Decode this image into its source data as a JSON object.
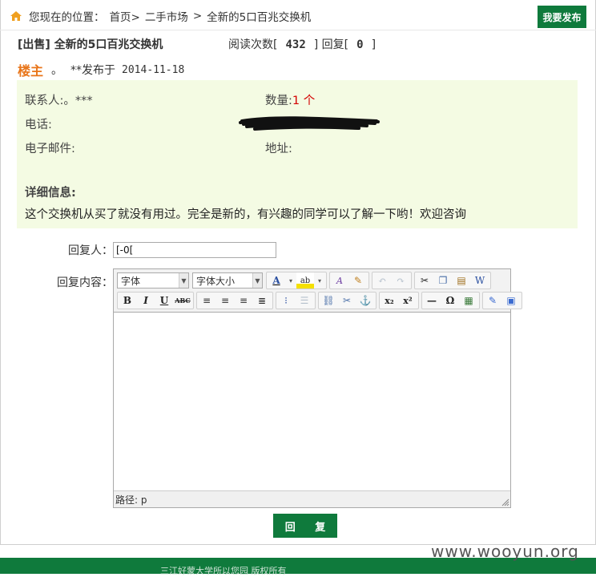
{
  "breadcrumb": {
    "prefix": "您现在的位置：",
    "items": [
      "首页>",
      "二手市场",
      ">",
      "全新的5口百兆交换机"
    ]
  },
  "publish_button": "我要发布",
  "post": {
    "title": "[出售] 全新的5口百兆交换机",
    "views_label": "阅读次数[",
    "views": "432",
    "replies_label": "] 回复[",
    "replies": "0",
    "replies_end": "]",
    "owner": "楼主",
    "dot": "。",
    "posted_label": "**发布于",
    "date": "2014-11-18"
  },
  "info": {
    "contact_label": "联系人:",
    "contact_value": "。***",
    "quantity_label": "数量:",
    "quantity_value": "1 个",
    "phone_label": "电话:",
    "email_label": "电子邮件:",
    "address_label": "地址:",
    "detail_title": "详细信息:",
    "detail_text": "这个交换机从买了就没有用过。完全是新的，有兴趣的同学可以了解一下哟！欢迎咨询"
  },
  "form": {
    "replier_label": "回复人：",
    "replier_value": "[-0[",
    "content_label": "回复内容：",
    "font_select": "字体",
    "size_select": "字体大小",
    "status_path": "路径: p",
    "submit": "回 复"
  },
  "footer": {
    "text": "三江好蒙大学所以您园 版权所有"
  },
  "watermark": "www.wooyun.org"
}
